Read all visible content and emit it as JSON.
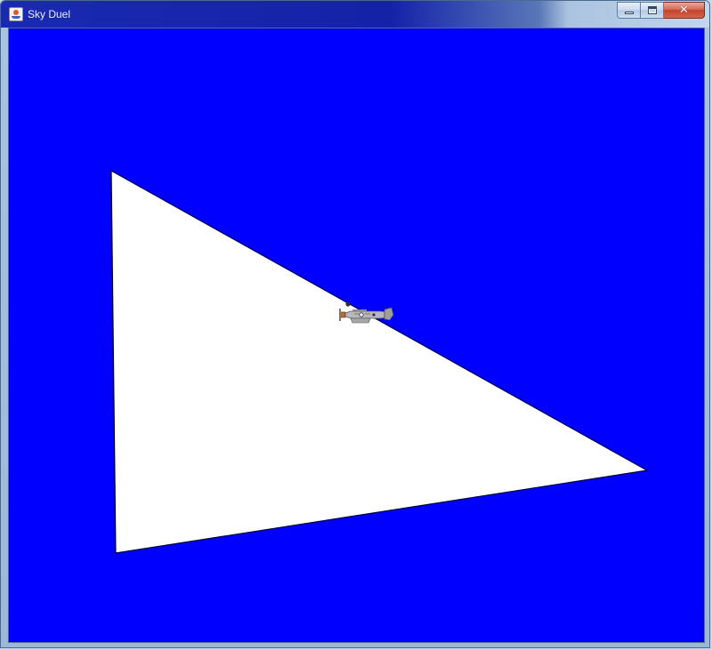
{
  "window": {
    "title": "Sky Duel"
  },
  "icons": {
    "app": "java-cup-icon",
    "minimize": "minimize-icon",
    "maximize": "maximize-icon",
    "close": "close-icon",
    "close_glyph": "✕"
  },
  "colors": {
    "sky": "#0000ff",
    "terrain": "#ffffff",
    "terrain_edge": "#000033",
    "plane_body": "#b8b8b8"
  },
  "scene": {
    "objects": [
      "triangle-terrain",
      "biplane-sprite"
    ]
  }
}
